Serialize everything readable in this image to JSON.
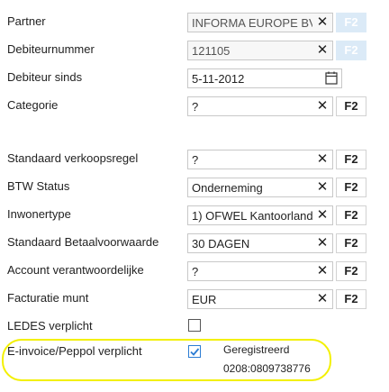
{
  "fields": {
    "partner": {
      "label": "Partner",
      "value": "INFORMA EUROPE BV",
      "button": "F2"
    },
    "debiteurnummer": {
      "label": "Debiteurnummer",
      "value": "121105",
      "button": "F2"
    },
    "debiteur_sinds": {
      "label": "Debiteur sinds",
      "value": "5-11-2012"
    },
    "categorie": {
      "label": "Categorie",
      "value": "?",
      "button": "F2"
    },
    "standaard_verkoopsregel": {
      "label": "Standaard verkoopsregel",
      "value": "?",
      "button": "F2"
    },
    "btw_status": {
      "label": "BTW Status",
      "value": "Onderneming",
      "button": "F2"
    },
    "inwonertype": {
      "label": "Inwonertype",
      "value": "1) OFWEL Kantoorland",
      "button": "F2"
    },
    "betaalvoorwaarde": {
      "label": "Standaard Betaalvoorwaarde",
      "value": "30 DAGEN",
      "button": "F2"
    },
    "account_verantwoordelijke": {
      "label": "Account verantwoordelijke",
      "value": "?",
      "button": "F2"
    },
    "facturatie_munt": {
      "label": "Facturatie munt",
      "value": "EUR",
      "button": "F2"
    },
    "ledes": {
      "label": "LEDES verplicht",
      "checked": false
    },
    "einvoice": {
      "label": "E-invoice/Peppol verplicht",
      "checked": true,
      "status": "Geregistreerd",
      "id": "0208:0809738776"
    }
  },
  "icons": {
    "clear": "close-icon",
    "calendar": "calendar-icon",
    "check": "checkmark-icon"
  },
  "colors": {
    "highlight": "#f3f000",
    "accent": "#2b7cd3",
    "disabled_button": "#dbeaf7"
  }
}
